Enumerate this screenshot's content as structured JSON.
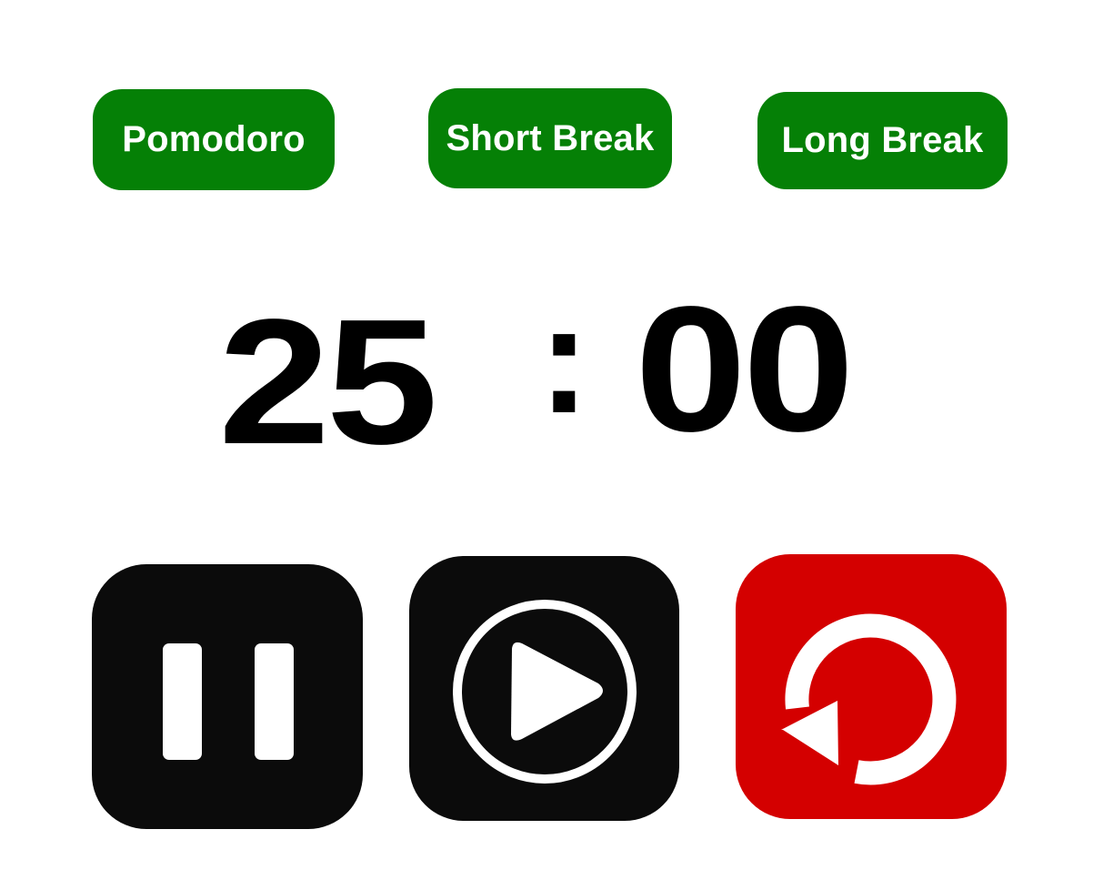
{
  "modes": {
    "pomodoro_label": "Pomodoro",
    "short_break_label": "Short Break",
    "long_break_label": "Long Break"
  },
  "timer": {
    "minutes": "25",
    "separator": ":",
    "seconds": "00"
  },
  "controls": {
    "pause_icon": "pause-icon",
    "play_icon": "play-icon",
    "reset_icon": "reset-icon"
  },
  "colors": {
    "mode_button": "#058006",
    "control_dark": "#0b0b0b",
    "reset_red": "#d40000",
    "text_white": "#ffffff"
  }
}
